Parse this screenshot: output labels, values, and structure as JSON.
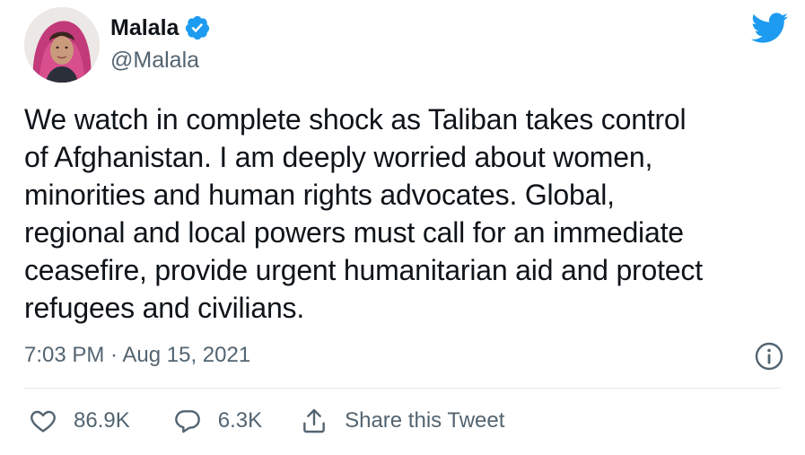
{
  "author": {
    "display_name": "Malala",
    "handle": "@Malala",
    "verified": true,
    "avatar_icon": "profile-photo"
  },
  "brand": {
    "icon": "twitter-bird-icon",
    "color": "#1d9bf0"
  },
  "tweet": {
    "text": "We watch in complete shock as Taliban takes control\nof Afghanistan. I am deeply worried about women,\nminorities and human rights advocates. Global,\nregional and local powers must call for an immediate\nceasefire, provide urgent humanitarian aid and protect\nrefugees and civilians.",
    "timestamp": "7:03 PM · Aug 15, 2021"
  },
  "actions": {
    "likes": "86.9K",
    "replies": "6.3K",
    "share_label": "Share this Tweet"
  },
  "colors": {
    "text": "#0f1419",
    "secondary": "#536471",
    "divider": "#e1e8ed",
    "verified": "#1d9bf0"
  }
}
